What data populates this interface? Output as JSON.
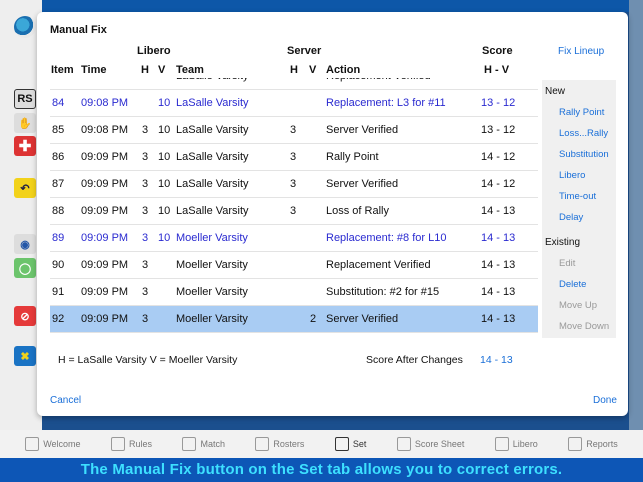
{
  "dialog": {
    "title": "Manual Fix",
    "fix_lineup": "Fix Lineup",
    "cancel": "Cancel",
    "done": "Done",
    "legend": "H = LaSalle Varsity   V = Moeller Varsity",
    "score_after_label": "Score After Changes",
    "score_after_value": "14 - 13"
  },
  "columns": {
    "libero": "Libero",
    "server": "Server",
    "score": "Score",
    "item": "Item",
    "time": "Time",
    "lib_h": "H",
    "lib_v": "V",
    "team": "Team",
    "srv_h": "H",
    "srv_v": "V",
    "action": "Action",
    "score_hv": "H - V"
  },
  "rows": [
    {
      "item": "",
      "time": "",
      "lh": "",
      "lv": "",
      "team": "LaSalle Varsity",
      "sh": "",
      "sv": "",
      "action": "Replacement Verified",
      "score": ""
    },
    {
      "item": "84",
      "time": "09:08 PM",
      "lh": "",
      "lv": "10",
      "team": "LaSalle Varsity",
      "sh": "",
      "sv": "",
      "action": "Replacement: L3 for #11",
      "score": "13 - 12"
    },
    {
      "item": "85",
      "time": "09:08 PM",
      "lh": "3",
      "lv": "10",
      "team": "LaSalle Varsity",
      "sh": "3",
      "sv": "",
      "action": "Server Verified",
      "score": "13 - 12"
    },
    {
      "item": "86",
      "time": "09:09 PM",
      "lh": "3",
      "lv": "10",
      "team": "LaSalle Varsity",
      "sh": "3",
      "sv": "",
      "action": "Rally Point",
      "score": "14 - 12"
    },
    {
      "item": "87",
      "time": "09:09 PM",
      "lh": "3",
      "lv": "10",
      "team": "LaSalle Varsity",
      "sh": "3",
      "sv": "",
      "action": "Server Verified",
      "score": "14 - 12"
    },
    {
      "item": "88",
      "time": "09:09 PM",
      "lh": "3",
      "lv": "10",
      "team": "LaSalle Varsity",
      "sh": "3",
      "sv": "",
      "action": "Loss of Rally",
      "score": "14 - 13"
    },
    {
      "item": "89",
      "time": "09:09 PM",
      "lh": "3",
      "lv": "10",
      "team": "Moeller Varsity",
      "sh": "",
      "sv": "",
      "action": "Replacement: #8 for L10",
      "score": "14 - 13"
    },
    {
      "item": "90",
      "time": "09:09 PM",
      "lh": "3",
      "lv": "",
      "team": "Moeller Varsity",
      "sh": "",
      "sv": "",
      "action": "Replacement Verified",
      "score": "14 - 13"
    },
    {
      "item": "91",
      "time": "09:09 PM",
      "lh": "3",
      "lv": "",
      "team": "Moeller Varsity",
      "sh": "",
      "sv": "",
      "action": "Substitution: #2 for #15",
      "score": "14 - 13"
    },
    {
      "item": "92",
      "time": "09:09 PM",
      "lh": "3",
      "lv": "",
      "team": "Moeller Varsity",
      "sh": "",
      "sv": "2",
      "action": "Server Verified",
      "score": "14 - 13"
    }
  ],
  "side": {
    "new_label": "New",
    "new_items": [
      "Rally Point",
      "Loss...Rally",
      "Substitution",
      "Libero",
      "Time-out",
      "Delay"
    ],
    "existing_label": "Existing",
    "existing_items": [
      "Edit",
      "Delete",
      "Move Up",
      "Move Down"
    ]
  },
  "left_toolbar": {
    "rs": "RS"
  },
  "tabs": [
    "Welcome",
    "Rules",
    "Match",
    "Rosters",
    "Set",
    "Score Sheet",
    "Libero",
    "Reports"
  ],
  "active_tab": "Set",
  "caption": "The Manual Fix button on the Set tab allows you to correct errors.",
  "colors": {
    "accent": "#1a6fd8",
    "highlight_text": "#2a2ad0",
    "selected_row": "#a9ccf3",
    "caption_text": "#3de0ff"
  }
}
